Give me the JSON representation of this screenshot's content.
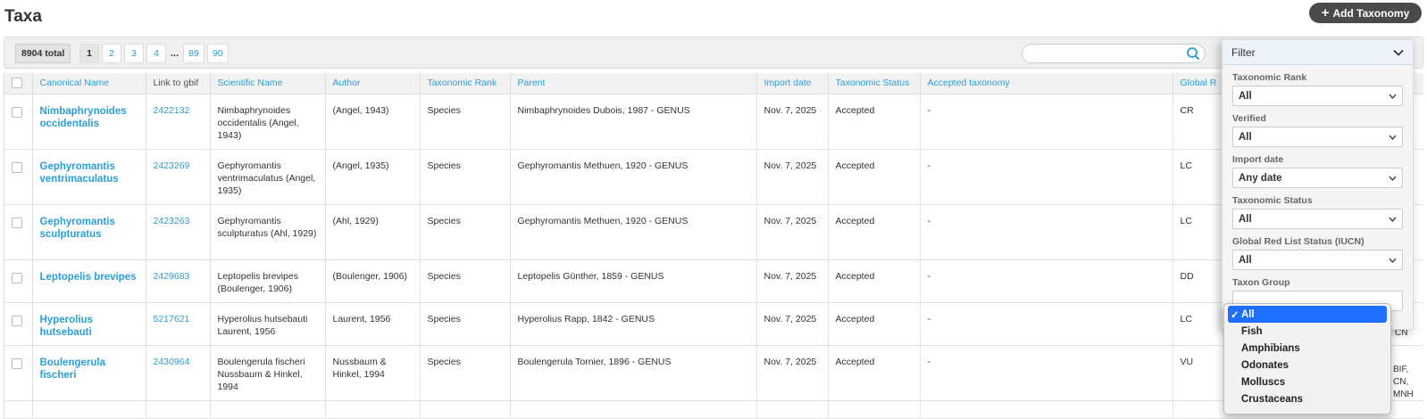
{
  "page": {
    "title": "Taxa",
    "add_button": "Add Taxonomy"
  },
  "toolbar": {
    "total": "8904 total",
    "pages": [
      "1",
      "2",
      "3",
      "4"
    ],
    "ellipsis": "...",
    "last_pages": [
      "89",
      "90"
    ],
    "search_placeholder": ""
  },
  "columns": [
    "Canonical Name",
    "Link to gbif",
    "Scientific Name",
    "Author",
    "Taxonomic Rank",
    "Parent",
    "Import date",
    "Taxonomic Status",
    "Accepted taxonomy",
    "Global R"
  ],
  "rows": [
    {
      "canonical": "Nimbaphrynoides occidentalis",
      "gbif": "2422132",
      "scientific": "Nimbaphrynoides occidentalis (Angel, 1943)",
      "author": "(Angel, 1943)",
      "rank": "Species",
      "parent": "Nimbaphrynoides Dubois, 1987 - GENUS",
      "date": "Nov. 7, 2025",
      "status": "Accepted",
      "accepted": "-",
      "redlist": "CR"
    },
    {
      "canonical": "Gephyromantis ventrimaculatus",
      "gbif": "2423269",
      "scientific": "Gephyromantis ventrimaculatus (Angel, 1935)",
      "author": "(Angel, 1935)",
      "rank": "Species",
      "parent": "Gephyromantis Methuen, 1920 - GENUS",
      "date": "Nov. 7, 2025",
      "status": "Accepted",
      "accepted": "-",
      "redlist": "LC"
    },
    {
      "canonical": "Gephyromantis sculpturatus",
      "gbif": "2423263",
      "scientific": "Gephyromantis sculpturatus (Ahl, 1929)",
      "author": "(Ahl, 1929)",
      "rank": "Species",
      "parent": "Gephyromantis Methuen, 1920 - GENUS",
      "date": "Nov. 7, 2025",
      "status": "Accepted",
      "accepted": "-",
      "redlist": "LC"
    },
    {
      "canonical": "Leptopelis brevipes",
      "gbif": "2429683",
      "scientific": "Leptopelis brevipes (Boulenger, 1906)",
      "author": "(Boulenger, 1906)",
      "rank": "Species",
      "parent": "Leptopelis Günther, 1859 - GENUS",
      "date": "Nov. 7, 2025",
      "status": "Accepted",
      "accepted": "-",
      "redlist": "DD"
    },
    {
      "canonical": "Hyperolius hutsebauti",
      "gbif": "5217621",
      "scientific": "Hyperolius hutsebauti Laurent, 1956",
      "author": "Laurent, 1956",
      "rank": "Species",
      "parent": "Hyperolius Rapp, 1842 - GENUS",
      "date": "Nov. 7, 2025",
      "status": "Accepted",
      "accepted": "-",
      "redlist": "LC"
    },
    {
      "canonical": "Boulengerula fischeri",
      "gbif": "2430964",
      "scientific": "Boulengerula fischeri Nussbaum & Hinkel, 1994",
      "author": "Nussbaum & Hinkel, 1994",
      "rank": "Species",
      "parent": "Boulengerula Tornier, 1896 - GENUS",
      "date": "Nov. 7, 2025",
      "status": "Accepted",
      "accepted": "-",
      "redlist": "VU"
    }
  ],
  "behind_panel": {
    "cn": "CN",
    "bif": "BIF,",
    "cn2": "CN,",
    "mnh": "MNH"
  },
  "filter": {
    "title": "Filter",
    "fields": [
      {
        "label": "Taxonomic Rank",
        "value": "All"
      },
      {
        "label": "Verified",
        "value": "All"
      },
      {
        "label": "Import date",
        "value": "Any date"
      },
      {
        "label": "Taxonomic Status",
        "value": "All"
      },
      {
        "label": "Global Red List Status (IUCN)",
        "value": "All"
      },
      {
        "label": "Taxon Group",
        "value": ""
      }
    ]
  },
  "dropdown": {
    "check": "✓",
    "options": [
      "All",
      "Fish",
      "Amphibians",
      "Odonates",
      "Molluscs",
      "Crustaceans"
    ]
  },
  "colors": {
    "accent": "#2a9fd6",
    "select_highlight": "#1e6fff",
    "add_button": "#4a4a4a"
  }
}
